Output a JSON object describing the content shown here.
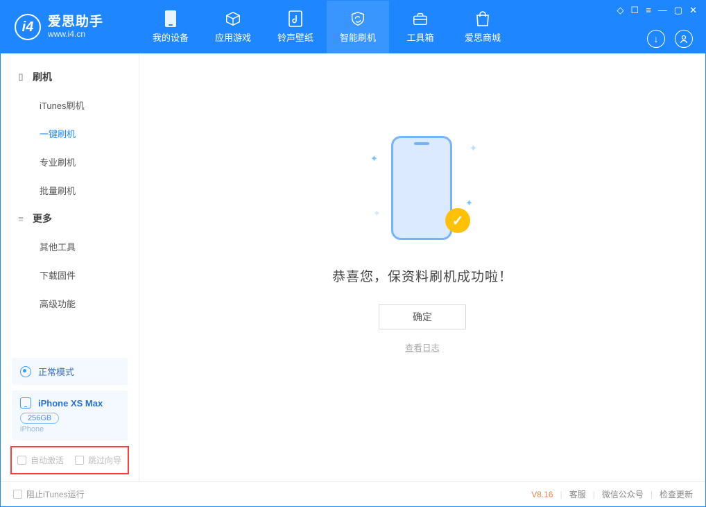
{
  "app": {
    "name": "爱思助手",
    "url": "www.i4.cn"
  },
  "nav": {
    "items": [
      {
        "label": "我的设备"
      },
      {
        "label": "应用游戏"
      },
      {
        "label": "铃声壁纸"
      },
      {
        "label": "智能刷机"
      },
      {
        "label": "工具箱"
      },
      {
        "label": "爱思商城"
      }
    ]
  },
  "sidebar": {
    "group1_title": "刷机",
    "group1_items": [
      "iTunes刷机",
      "一键刷机",
      "专业刷机",
      "批量刷机"
    ],
    "group2_title": "更多",
    "group2_items": [
      "其他工具",
      "下载固件",
      "高级功能"
    ]
  },
  "device": {
    "mode": "正常模式",
    "name": "iPhone XS Max",
    "capacity": "256GB",
    "type": "iPhone"
  },
  "options": {
    "auto_activate": "自动激活",
    "skip_guide": "跳过向导"
  },
  "main": {
    "success": "恭喜您，保资料刷机成功啦！",
    "ok": "确定",
    "log": "查看日志"
  },
  "footer": {
    "block_itunes": "阻止iTunes运行",
    "version": "V8.16",
    "links": [
      "客服",
      "微信公众号",
      "检查更新"
    ]
  }
}
